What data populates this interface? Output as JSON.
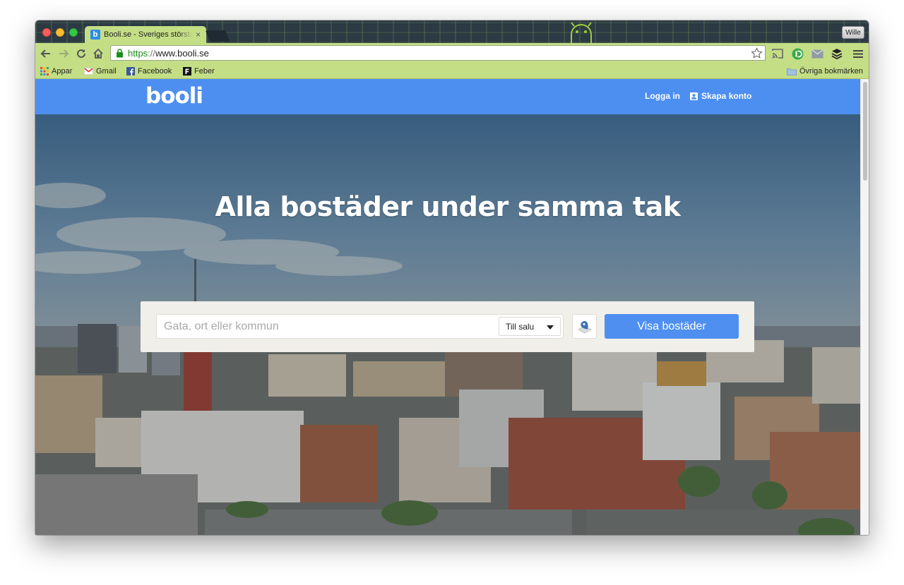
{
  "browser": {
    "tab": {
      "favicon_letter": "b",
      "title": "Booli.se - Sveriges största bostadssajt",
      "close_glyph": "×"
    },
    "profile_name": "Wille",
    "address": {
      "scheme": "https",
      "scheme_sep": "://",
      "host": "www.booli.se"
    },
    "bookmarks": [
      {
        "label": "Appar",
        "icon": "apps-grid-icon"
      },
      {
        "label": "Gmail",
        "icon": "gmail-icon"
      },
      {
        "label": "Facebook",
        "icon": "facebook-icon"
      },
      {
        "label": "Feber",
        "icon": "feber-icon"
      }
    ],
    "other_bookmarks": "Övriga bokmärken",
    "accent": "#c4de86"
  },
  "site": {
    "logo": "booli",
    "nav": {
      "login": "Logga in",
      "signup": "Skapa konto"
    },
    "hero": {
      "title": "Alla bostäder under samma tak"
    },
    "search": {
      "placeholder": "Gata, ort eller kommun",
      "value": "",
      "type_selected": "Till salu",
      "submit": "Visa bostäder"
    },
    "colors": {
      "brand": "#4d8ff0",
      "button": "#4f8ff0",
      "panel": "#f1efea"
    }
  }
}
